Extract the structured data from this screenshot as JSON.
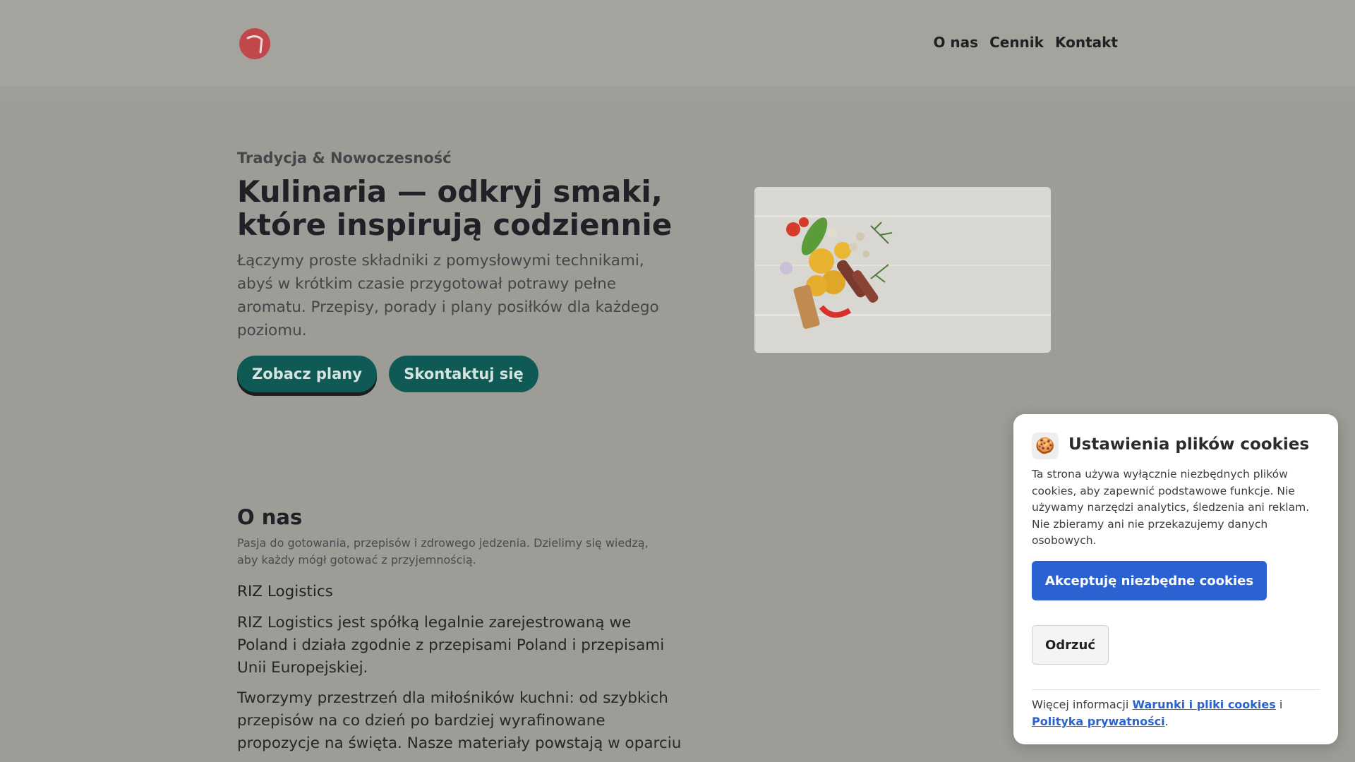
{
  "header": {
    "logo_alt": "",
    "nav": [
      {
        "label": "O nas"
      },
      {
        "label": "Cennik"
      },
      {
        "label": "Kontakt"
      }
    ]
  },
  "hero": {
    "eyebrow": "Tradycja & Nowoczesność",
    "title": "Kulinaria — odkryj smaki, które inspirują codziennie",
    "text": "Łączymy proste składniki z pomysłowymi technikami, abyś w krótkim czasie przygotował potrawy pełne aromatu. Przepisy, porady i plany posiłków dla każdego poziomu.",
    "primary_button": "Zobacz plany",
    "secondary_button": "Skontaktuj się"
  },
  "about": {
    "title": "O nas",
    "subtitle": "Pasja do gotowania, przepisów i zdrowego jedzenia. Dzielimy się wiedzą, aby każdy mógł gotować z przyjemnością.",
    "company": "RIZ Logistics",
    "para1": "RIZ Logistics jest spółką legalnie zarejestrowaną we Poland i działa zgodnie z przepisami Poland i przepisami Unii Europejskiej.",
    "para2": "Tworzymy przestrzeń dla miłośników kuchni: od szybkich przepisów na co dzień po bardziej wyrafinowane propozycje na święta. Nasze materiały powstają w oparciu"
  },
  "cookie": {
    "icon": "🍪",
    "title": "Ustawienia plików cookies",
    "text": "Ta strona używa wyłącznie niezbędnych plików cookies, aby zapewnić podstawowe funkcje. Nie używamy narzędzi analytics, śledzenia ani reklam. Nie zbieramy ani nie przekazujemy danych osobowych.",
    "accept": "Akceptuję niezbędne cookies",
    "reject": "Odrzuć",
    "more_prefix": "Więcej informacji",
    "link_terms": "Warunki i pliki cookies",
    "and": "i",
    "link_privacy": "Polityka prywatności",
    "suffix": "."
  },
  "colors": {
    "accent_teal": "#0f5a55",
    "logo_red": "#c0474a",
    "cookie_blue": "#2a62d1"
  }
}
